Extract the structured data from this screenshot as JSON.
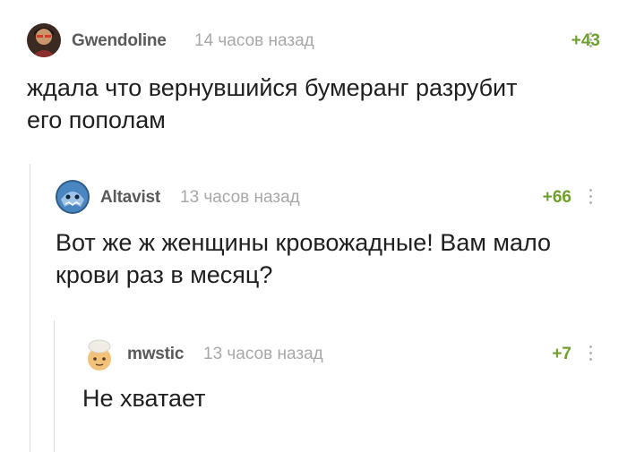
{
  "comments": [
    {
      "author": "Gwendoline",
      "time": "14 часов назад",
      "rating": "+43",
      "text_lines": [
        "ждала что вернувшийся бумеранг разрубит",
        "его пополам"
      ]
    },
    {
      "author": "Altavist",
      "time": "13 часов назад",
      "rating": "+66",
      "text_lines": [
        "Вот же ж женщины кровожадные! Вам мало",
        "крови раз в месяц?"
      ]
    },
    {
      "author": "mwstic",
      "time": "13 часов назад",
      "rating": "+7",
      "text_lines": [
        "Не хватает"
      ]
    }
  ]
}
